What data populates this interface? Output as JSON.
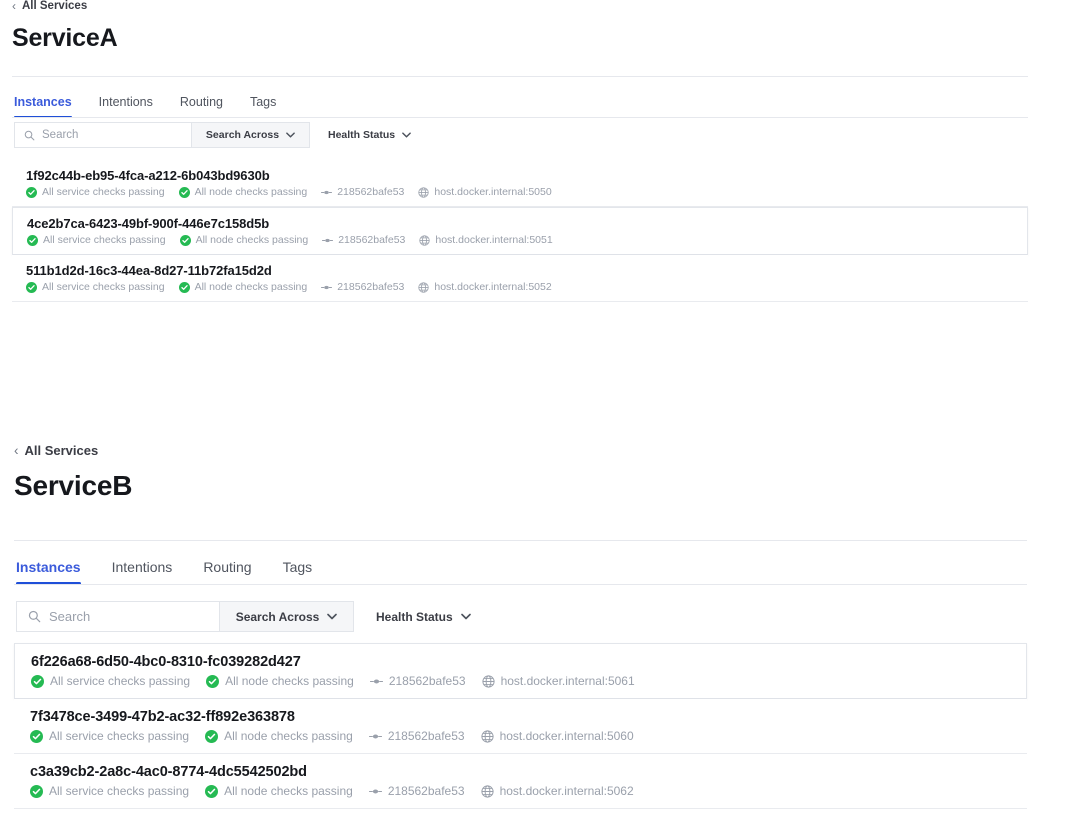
{
  "sections": [
    {
      "breadcrumb": "All Services",
      "title": "ServiceA",
      "tabs": [
        {
          "label": "Instances",
          "active": true
        },
        {
          "label": "Intentions",
          "active": false
        },
        {
          "label": "Routing",
          "active": false
        },
        {
          "label": "Tags",
          "active": false
        }
      ],
      "filters": {
        "search_placeholder": "Search",
        "search_value": "",
        "search_across_label": "Search Across",
        "health_status_label": "Health Status"
      },
      "instances": [
        {
          "id": "1f92c44b-eb95-4fca-a212-6b043bd9630b",
          "service_checks": "All service checks passing",
          "node_checks": "All node checks passing",
          "node": "218562bafe53",
          "address": "host.docker.internal:5050",
          "hovered": false
        },
        {
          "id": "4ce2b7ca-6423-49bf-900f-446e7c158d5b",
          "service_checks": "All service checks passing",
          "node_checks": "All node checks passing",
          "node": "218562bafe53",
          "address": "host.docker.internal:5051",
          "hovered": true
        },
        {
          "id": "511b1d2d-16c3-44ea-8d27-11b72fa15d2d",
          "service_checks": "All service checks passing",
          "node_checks": "All node checks passing",
          "node": "218562bafe53",
          "address": "host.docker.internal:5052",
          "hovered": false
        }
      ]
    },
    {
      "breadcrumb": "All Services",
      "title": "ServiceB",
      "tabs": [
        {
          "label": "Instances",
          "active": true
        },
        {
          "label": "Intentions",
          "active": false
        },
        {
          "label": "Routing",
          "active": false
        },
        {
          "label": "Tags",
          "active": false
        }
      ],
      "filters": {
        "search_placeholder": "Search",
        "search_value": "",
        "search_across_label": "Search Across",
        "health_status_label": "Health Status"
      },
      "instances": [
        {
          "id": "6f226a68-6d50-4bc0-8310-fc039282d427",
          "service_checks": "All service checks passing",
          "node_checks": "All node checks passing",
          "node": "218562bafe53",
          "address": "host.docker.internal:5061",
          "hovered": true
        },
        {
          "id": "7f3478ce-3499-47b2-ac32-ff892e363878",
          "service_checks": "All service checks passing",
          "node_checks": "All node checks passing",
          "node": "218562bafe53",
          "address": "host.docker.internal:5060",
          "hovered": false
        },
        {
          "id": "c3a39cb2-2a8c-4ac0-8774-4dc5542502bd",
          "service_checks": "All service checks passing",
          "node_checks": "All node checks passing",
          "node": "218562bafe53",
          "address": "host.docker.internal:5062",
          "hovered": false
        }
      ]
    }
  ],
  "icons": {
    "back_chevron": "‹",
    "caret_down": "⌄",
    "search": "magnifier-icon",
    "check": "check-circle-icon",
    "node": "node-icon",
    "globe": "globe-icon"
  },
  "colors": {
    "accent": "#1f4fd8",
    "tab_active_text": "#3b5bdb",
    "health_pass": "#25ba53",
    "muted_text": "#9aa0ab",
    "title": "#16181d",
    "border": "#e6e8ed",
    "filter_btn_bg": "#f5f6f8"
  }
}
